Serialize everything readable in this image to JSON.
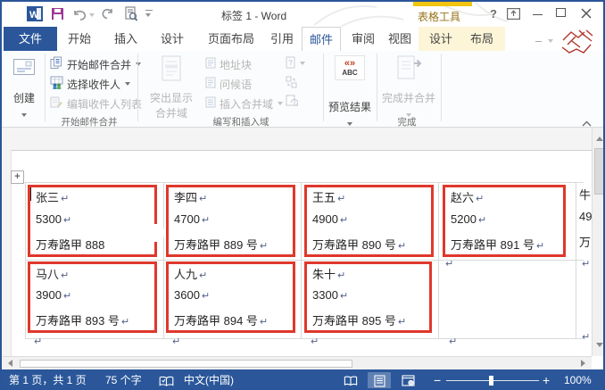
{
  "colors": {
    "accent": "#2b579a",
    "contextual_gold": "#f2c40e",
    "label_border_red": "#df382c"
  },
  "title_bar": {
    "title": "标签 1 - Word",
    "contextual_tool_title": "表格工具",
    "help": "?",
    "qat_icons": [
      "word-logo",
      "save",
      "undo",
      "redo",
      "print-preview",
      "customize-qat"
    ]
  },
  "tabs": {
    "file": "文件",
    "home": "开始",
    "insert": "插入",
    "design": "设计",
    "page_layout": "页面布局",
    "references": "引用",
    "mailings": "邮件",
    "review": "审阅",
    "view": "视图",
    "table_design": "设计",
    "table_layout": "布局",
    "active": "邮件"
  },
  "ribbon": {
    "create_label": "创建",
    "start_group_label": "开始邮件合并",
    "start_mail_merge": "开始邮件合并",
    "select_recipients": "选择收件人",
    "edit_recipient_list": "编辑收件人列表",
    "write_group_label": "编写和插入域",
    "highlight_line1": "突出显示",
    "highlight_line2": "合并域",
    "address_block": "地址块",
    "greeting_line": "问候语",
    "insert_merge_field": "插入合并域",
    "small_icons": [
      "rules",
      "match-fields",
      "update-labels"
    ],
    "preview_results": "预览结果",
    "preview_icon_top": "«»",
    "preview_icon_bottom": "ABC",
    "finish_merge": "完成并合并",
    "finish_group_label": "完成"
  },
  "document": {
    "pilcrow": "↵",
    "cells": [
      {
        "name": "张三",
        "amount": "5300",
        "address": "万寿路甲  888"
      },
      {
        "name": "李四",
        "amount": "4700",
        "address": "万寿路甲 889 号"
      },
      {
        "name": "王五",
        "amount": "4900",
        "address": "万寿路甲 890 号"
      },
      {
        "name": "赵六",
        "amount": "5200",
        "address": "万寿路甲 891 号"
      },
      {
        "name": "马八",
        "amount": "3900",
        "address": "万寿路甲 893 号"
      },
      {
        "name": "人九",
        "amount": "3600",
        "address": "万寿路甲 894 号"
      },
      {
        "name": "朱十",
        "amount": "3300",
        "address": "万寿路甲 895 号"
      }
    ],
    "partial_cell": {
      "line1": "牛",
      "line2": "49",
      "line3": "万"
    }
  },
  "status_bar": {
    "page_info": "第 1 页，共 1 页",
    "word_count": "75 个字",
    "language": "中文(中国)",
    "zoom_minus": "−",
    "zoom_plus": "+",
    "zoom_level": "100%",
    "icons": [
      "proofing-book",
      "read-mode",
      "print-layout",
      "web-layout"
    ]
  }
}
